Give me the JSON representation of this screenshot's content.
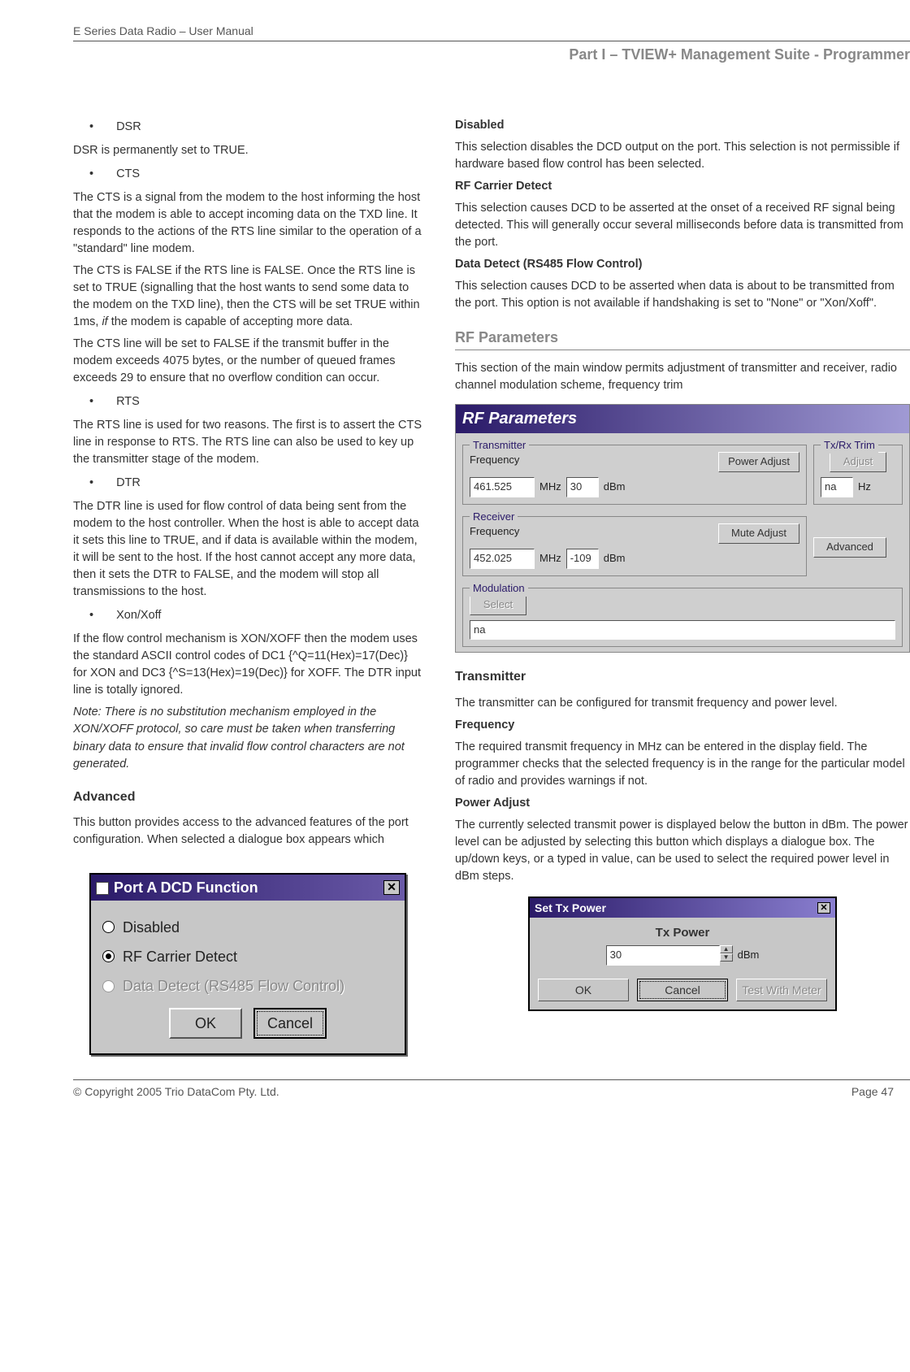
{
  "header": {
    "left": "E Series Data Radio – User Manual",
    "right": "Part I – TVIEW+ Management Suite - Programmer"
  },
  "footer": {
    "left": "© Copyright 2005 Trio DataCom Pty. Ltd.",
    "right": "Page 47"
  },
  "left_col": {
    "b1": "DSR",
    "p1": "DSR is permanently set to TRUE.",
    "b2": "CTS",
    "p2": "The CTS is a signal from the modem to the host informing the host that the modem is able to accept incoming data on the TXD line. It responds to the actions of the RTS line similar to the operation of a \"standard\" line modem.",
    "p3": "The CTS is FALSE if the RTS line is FALSE. Once the RTS line is set to TRUE (signalling that the host wants to send some data to the modem on the TXD line), then the CTS will be set TRUE within 1ms, if the modem is capable of accepting more data.",
    "p4": "The CTS line will be set to FALSE if the transmit buffer in the modem exceeds 4075 bytes, or the number of queued frames exceeds 29 to ensure that no overflow condition can occur.",
    "b3": "RTS",
    "p5": "The RTS line is used for two reasons.  The first is to assert the CTS line in response to RTS. The RTS line can also be used to key up the transmitter stage of the modem.",
    "b4": "DTR",
    "p6": "The DTR line is used for flow control of data being sent from the modem to the host controller.  When the host is able to accept data it sets this line to TRUE, and if data is available within the modem, it will be sent to the host.  If the host cannot accept any more data, then it sets the DTR to FALSE, and the modem will stop all transmissions to the host.",
    "b5": "Xon/Xoff",
    "p7": "If the flow control mechanism is XON/XOFF then the modem uses the standard ASCII control codes of DC1 {^Q=11(Hex)=17(Dec)} for XON and DC3 {^S=13(Hex)=19(Dec)} for XOFF. The DTR input line is totally ignored.",
    "note": "Note: There is no substitution mechanism employed in the XON/XOFF protocol, so care must be taken when transferring binary data to ensure that invalid flow control characters are not generated.",
    "advanced_h": "Advanced",
    "advanced_p": "This button provides access to the advanced features of the port configuration. When selected a dialogue box appears which"
  },
  "dcd_dialog": {
    "title": "Port A DCD Function",
    "opt1": "Disabled",
    "opt2": "RF Carrier Detect",
    "opt3": "Data Detect (RS485 Flow Control)",
    "ok": "OK",
    "cancel": "Cancel"
  },
  "right_col": {
    "h_disabled": "Disabled",
    "p_disabled": "This selection disables the DCD output on the port. This selection is not permissible if hardware based flow control has been selected.",
    "h_rfcd": "RF Carrier Detect",
    "p_rfcd": "This selection causes DCD to be asserted at the onset of a received RF signal being detected. This will generally occur several milliseconds before data is transmitted from the port.",
    "h_dd": "Data Detect (RS485 Flow Control)",
    "p_dd": "This selection causes DCD to be asserted when data is about to be transmitted from the port. This option is not available if handshaking is set to \"None\" or \"Xon/Xoff\".",
    "h_rfparams": "RF Parameters",
    "p_rfparams": "This section of the main window permits adjustment of transmitter and receiver, radio channel modulation scheme, frequency trim",
    "h_transmitter": "Transmitter",
    "p_transmitter": "The transmitter can be configured for transmit frequency and power level.",
    "h_freq": "Frequency",
    "p_freq": "The required transmit frequency in MHz can be entered in the display field.  The programmer checks that the selected frequency is in the range for the particular model of radio and provides warnings if not.",
    "h_pow": "Power Adjust",
    "p_pow": "The currently selected transmit power is displayed below the button in dBm. The power level can be adjusted by selecting this button which displays a dialogue box. The up/down keys, or a typed in value, can be used to select the required power level in dBm steps."
  },
  "rf_panel": {
    "title": "RF Parameters",
    "tx_legend": "Transmitter",
    "tx_freq_label": "Frequency",
    "tx_freq": "461.525",
    "mhz": "MHz",
    "pow_adjust_btn": "Power Adjust",
    "tx_pow": "30",
    "dbm": "dBm",
    "trim_legend": "Tx/Rx Trim",
    "trim_adjust": "Adjust",
    "trim_val": "na",
    "hz": "Hz",
    "rx_legend": "Receiver",
    "rx_freq_label": "Frequency",
    "rx_freq": "452.025",
    "mute_btn": "Mute Adjust",
    "rx_mute": "-109",
    "advanced_btn": "Advanced",
    "mod_legend": "Modulation",
    "select_btn": "Select",
    "mod_val": "na"
  },
  "txpow": {
    "title": "Set Tx Power",
    "label": "Tx Power",
    "value": "30",
    "unit": "dBm",
    "ok": "OK",
    "cancel": "Cancel",
    "test": "Test With Meter"
  }
}
